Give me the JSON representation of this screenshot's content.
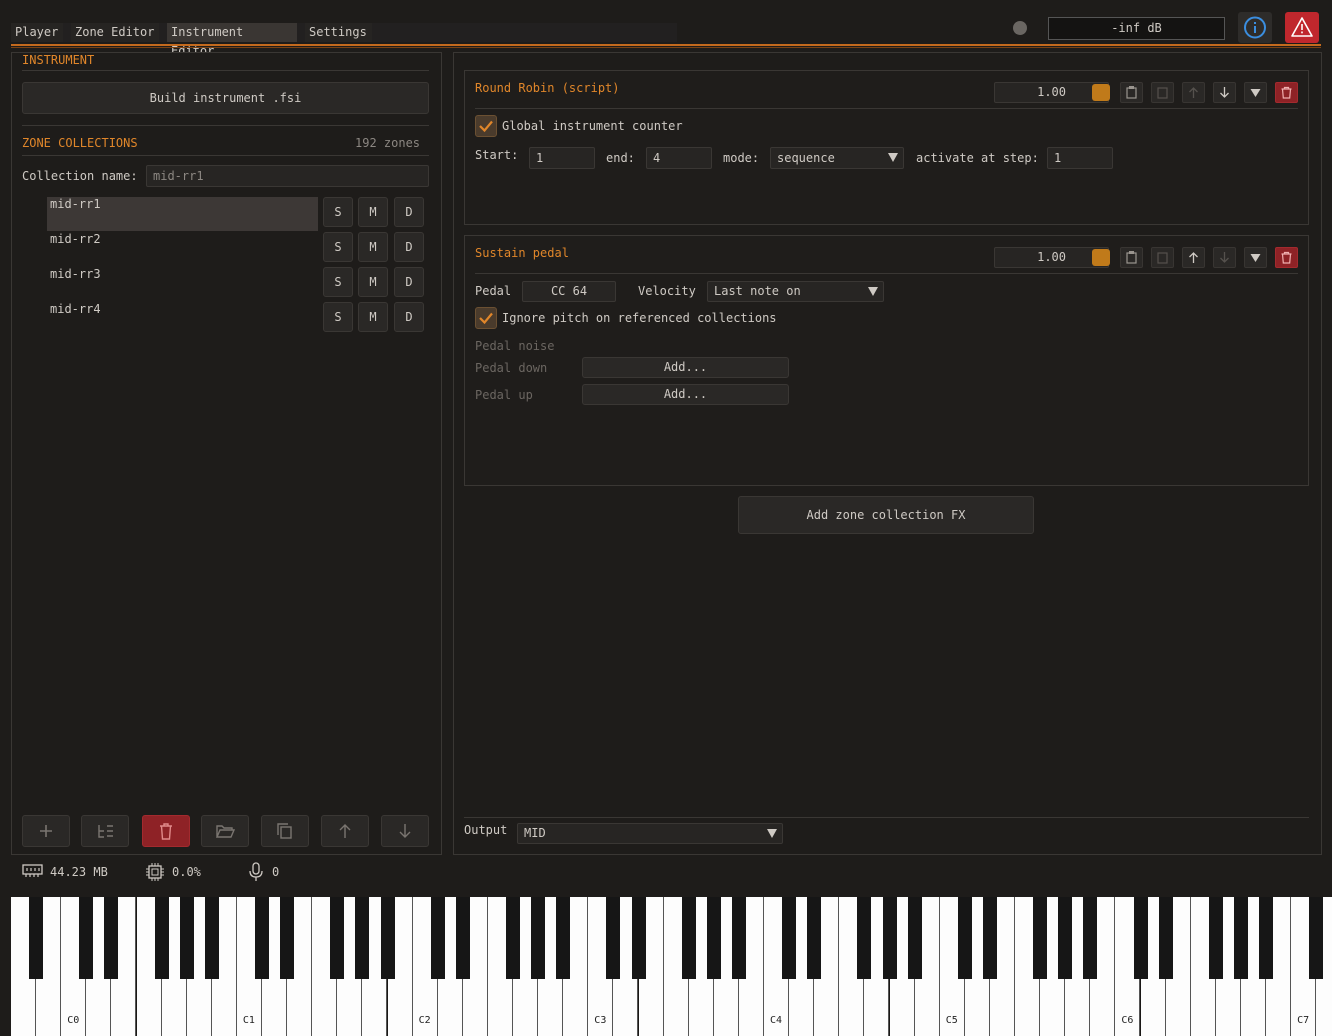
{
  "tabs": [
    {
      "label": "Player"
    },
    {
      "label": "Zone Editor"
    },
    {
      "label": "Instrument Editor"
    },
    {
      "label": "Settings"
    }
  ],
  "header": {
    "level": "-inf dB"
  },
  "left": {
    "instrument_title": "INSTRUMENT",
    "build_label": "Build instrument .fsi",
    "zone_collections_title": "ZONE COLLECTIONS",
    "zone_count": "192 zones",
    "collection_name_label": "Collection name:",
    "collection_name_value": "mid-rr1",
    "collections": [
      {
        "name": "mid-rr1"
      },
      {
        "name": "mid-rr2"
      },
      {
        "name": "mid-rr3"
      },
      {
        "name": "mid-rr4"
      }
    ],
    "smd": {
      "s": "S",
      "m": "M",
      "d": "D"
    }
  },
  "fx": {
    "round_robin": {
      "title": "Round Robin (script)",
      "value": "1.00",
      "global_counter_label": "Global instrument counter",
      "start_label": "Start:",
      "start_value": "1",
      "end_label": "end:",
      "end_value": "4",
      "mode_label": "mode:",
      "mode_value": "sequence",
      "activate_label": "activate at step:",
      "activate_value": "1"
    },
    "sustain": {
      "title": "Sustain pedal",
      "value": "1.00",
      "pedal_label": "Pedal",
      "pedal_value": "CC 64",
      "velocity_label": "Velocity",
      "velocity_value": "Last note on",
      "ignore_pitch_label": "Ignore pitch on referenced collections",
      "pedal_noise_label": "Pedal noise",
      "pedal_down_label": "Pedal down",
      "pedal_up_label": "Pedal up",
      "add_label": "Add..."
    },
    "add_fx_label": "Add zone collection FX",
    "output_label": "Output",
    "output_value": "MID"
  },
  "status": {
    "memory": "44.23 MB",
    "cpu": "0.0%",
    "voices": "0"
  },
  "keyboard": {
    "octave_labels": [
      "C0",
      "C1",
      "C2",
      "C3",
      "C4",
      "C5",
      "C6",
      "C7"
    ]
  },
  "colors": {
    "accent": "#e0862a",
    "danger": "#c0272d",
    "info": "#3b8ee0"
  }
}
